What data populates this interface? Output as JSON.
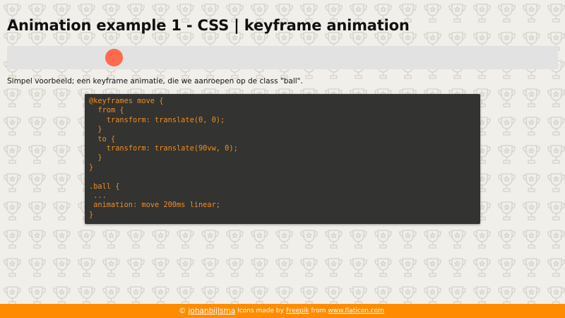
{
  "header": {
    "title": "Animation example 1 - CSS | keyframe animation"
  },
  "demo": {
    "ball_color": "#ff6a4d",
    "track_color": "#e2e2e2"
  },
  "description": "Simpel voorbeeld; een keyframe animatie, die we aanroepen op de class \"ball\".",
  "code": {
    "lines": [
      "@keyframes move {",
      "  from {",
      "    transform: translate(0, 0);",
      "  }",
      "  to {",
      "    transform: translate(90vw, 0);",
      "  }",
      "}",
      "",
      ".ball {",
      " ...",
      " animation: move 200ms linear;",
      "}"
    ]
  },
  "footer": {
    "copyright_symbol": "©",
    "author": "johanbijlsma",
    "credit_prefix": "Icons made by",
    "credit_author": "Freepik",
    "credit_from": "from",
    "credit_site": "www.flaticon.com",
    "background_color": "#ff8c00"
  },
  "colors": {
    "page_background": "#f1efea",
    "pattern": "#d9d6cf",
    "code_background": "#333331",
    "code_text": "#f08c1f"
  },
  "icons": {
    "background_pattern": "trophy-icon"
  }
}
